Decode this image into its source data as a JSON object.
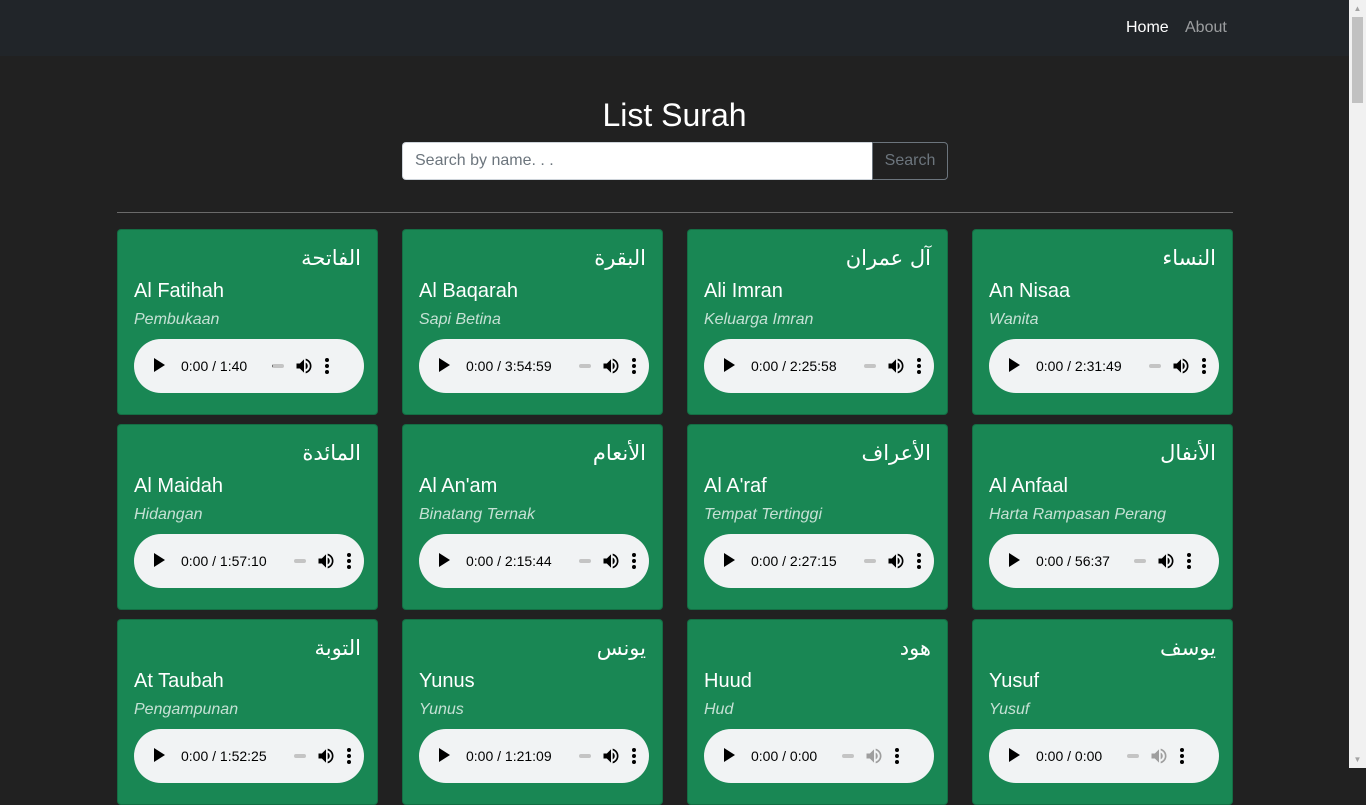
{
  "nav": {
    "home": "Home",
    "about": "About"
  },
  "title": "List Surah",
  "search": {
    "placeholder": "Search by name. . .",
    "button": "Search"
  },
  "surahs": [
    {
      "arabic": "الفاتحة",
      "name": "Al Fatihah",
      "meaning": "Pembukaan",
      "time": "0:00 / 1:40",
      "progress": 0.05
    },
    {
      "arabic": "البقرة",
      "name": "Al Baqarah",
      "meaning": "Sapi Betina",
      "time": "0:00 / 3:54:59",
      "progress": 0
    },
    {
      "arabic": "آل عمران",
      "name": "Ali Imran",
      "meaning": "Keluarga Imran",
      "time": "0:00 / 2:25:58",
      "progress": 0
    },
    {
      "arabic": "النساء",
      "name": "An Nisaa",
      "meaning": "Wanita",
      "time": "0:00 / 2:31:49",
      "progress": 0
    },
    {
      "arabic": "المائدة",
      "name": "Al Maidah",
      "meaning": "Hidangan",
      "time": "0:00 / 1:57:10",
      "progress": 0
    },
    {
      "arabic": "الأنعام",
      "name": "Al An'am",
      "meaning": "Binatang Ternak",
      "time": "0:00 / 2:15:44",
      "progress": 0
    },
    {
      "arabic": "الأعراف",
      "name": "Al A'raf",
      "meaning": "Tempat Tertinggi",
      "time": "0:00 / 2:27:15",
      "progress": 0
    },
    {
      "arabic": "الأنفال",
      "name": "Al Anfaal",
      "meaning": "Harta Rampasan Perang",
      "time": "0:00 / 56:37",
      "progress": 0
    },
    {
      "arabic": "التوبة",
      "name": "At Taubah",
      "meaning": "Pengampunan",
      "time": "0:00 / 1:52:25",
      "progress": 0
    },
    {
      "arabic": "يونس",
      "name": "Yunus",
      "meaning": "Yunus",
      "time": "0:00 / 1:21:09",
      "progress": 0
    },
    {
      "arabic": "هود",
      "name": "Huud",
      "meaning": "Hud",
      "time": "0:00 / 0:00",
      "progress": 0
    },
    {
      "arabic": "يوسف",
      "name": "Yusuf",
      "meaning": "Yusuf",
      "time": "0:00 / 0:00",
      "progress": 0
    }
  ],
  "icons": {
    "play": "play-icon",
    "volume": "volume-icon",
    "more": "more-vert-icon"
  },
  "colors": {
    "card": "#198754",
    "background": "#212121",
    "navbar": "#212529"
  }
}
